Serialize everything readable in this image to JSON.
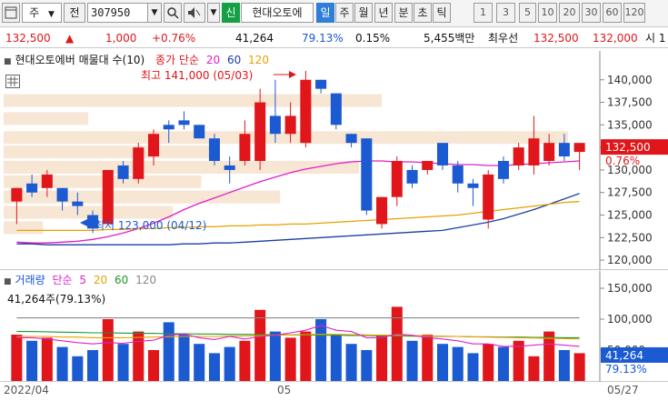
{
  "toolbar": {
    "chart_type_label": "주",
    "prev_label": "전",
    "code_value": "307950",
    "signal_label": "신",
    "stock_name": "현대오토에",
    "period_tabs": [
      "일",
      "주",
      "월",
      "년",
      "분",
      "초",
      "틱"
    ],
    "active_period": "일",
    "interval_buttons": [
      "1",
      "3",
      "5",
      "10",
      "20",
      "30",
      "60",
      "120"
    ]
  },
  "quote": {
    "price": "132,500",
    "direction": "▲",
    "change": "1,000",
    "change_pct": "+0.76%",
    "volume": "41,264",
    "volume_ratio": "79.13%",
    "turnover_ratio": "0.15%",
    "amount": "5,455백만",
    "best_ask_label": "최우선",
    "best_ask": "132,500",
    "best_bid": "132,000",
    "market_label": "시 1"
  },
  "price_panel": {
    "title": "현대오토에버 매물대 수(10)",
    "ma_label": "종가 단순",
    "ma_periods": [
      "20",
      "60",
      "120"
    ],
    "ma_colors": [
      "#e020c8",
      "#1d3fa0",
      "#e8a000"
    ],
    "high_annotation": "최고 141,000 (05/03)",
    "low_annotation": "최저 123,000 (04/12)",
    "current_price_tag": "132,500",
    "current_change_tag": "0.76%",
    "axis_labels": [
      "140,000",
      "137,500",
      "135,000",
      "132,500",
      "130,000",
      "127,500",
      "125,000",
      "122,500",
      "120,000"
    ]
  },
  "volume_panel": {
    "title": "거래량",
    "ma_label": "단순",
    "ma_periods": [
      "5",
      "20",
      "60",
      "120"
    ],
    "ma_colors": [
      "#e020c8",
      "#e8a000",
      "#1a9a2a",
      "#888888"
    ],
    "current_volume_text": "41,264주(79.13%)",
    "volume_tag": "41,264",
    "ratio_tag": "79.13%",
    "axis_labels": [
      "150,000",
      "100,000",
      "50,000"
    ]
  },
  "xaxis": {
    "labels": [
      "2022/04",
      "05",
      "05/27"
    ]
  },
  "colors": {
    "up": "#e0161b",
    "down": "#1c5ad2",
    "accent": "#2f7fd8",
    "volume_profile": "#f8e6d4"
  },
  "chart_data": [
    {
      "type": "candlestick",
      "ylim": [
        119000,
        143000
      ],
      "candles": [
        {
          "o": 126500,
          "h": 128000,
          "l": 124000,
          "c": 128000
        },
        {
          "o": 128500,
          "h": 129500,
          "l": 127000,
          "c": 127500
        },
        {
          "o": 128000,
          "h": 130000,
          "l": 127000,
          "c": 129500
        },
        {
          "o": 128000,
          "h": 128000,
          "l": 125500,
          "c": 126500
        },
        {
          "o": 126500,
          "h": 127500,
          "l": 125000,
          "c": 126000
        },
        {
          "o": 125000,
          "h": 125500,
          "l": 123000,
          "c": 123500
        },
        {
          "o": 124000,
          "h": 130000,
          "l": 124000,
          "c": 130000
        },
        {
          "o": 130500,
          "h": 131000,
          "l": 128500,
          "c": 129000
        },
        {
          "o": 129000,
          "h": 133000,
          "l": 128500,
          "c": 132500
        },
        {
          "o": 131500,
          "h": 134500,
          "l": 130500,
          "c": 134000
        },
        {
          "o": 135000,
          "h": 135500,
          "l": 133000,
          "c": 134500
        },
        {
          "o": 135500,
          "h": 136500,
          "l": 134500,
          "c": 135000
        },
        {
          "o": 135000,
          "h": 135000,
          "l": 133500,
          "c": 133500
        },
        {
          "o": 133500,
          "h": 134000,
          "l": 130500,
          "c": 131000
        },
        {
          "o": 130500,
          "h": 131500,
          "l": 128500,
          "c": 130000
        },
        {
          "o": 131000,
          "h": 135500,
          "l": 130500,
          "c": 134000
        },
        {
          "o": 131000,
          "h": 139000,
          "l": 130000,
          "c": 137500
        },
        {
          "o": 136000,
          "h": 140000,
          "l": 133000,
          "c": 134000
        },
        {
          "o": 134000,
          "h": 137500,
          "l": 133000,
          "c": 136000
        },
        {
          "o": 133000,
          "h": 141000,
          "l": 132500,
          "c": 140000
        },
        {
          "o": 140000,
          "h": 140000,
          "l": 138500,
          "c": 139000
        },
        {
          "o": 138500,
          "h": 138500,
          "l": 134500,
          "c": 135000
        },
        {
          "o": 134000,
          "h": 134000,
          "l": 132500,
          "c": 133000
        },
        {
          "o": 133500,
          "h": 133500,
          "l": 125000,
          "c": 125500
        },
        {
          "o": 124000,
          "h": 127000,
          "l": 123500,
          "c": 127000
        },
        {
          "o": 127000,
          "h": 131500,
          "l": 126000,
          "c": 131000
        },
        {
          "o": 130000,
          "h": 130500,
          "l": 128000,
          "c": 128500
        },
        {
          "o": 130000,
          "h": 130500,
          "l": 129500,
          "c": 131000
        },
        {
          "o": 133000,
          "h": 133000,
          "l": 130000,
          "c": 130500
        },
        {
          "o": 130500,
          "h": 131000,
          "l": 127500,
          "c": 128500
        },
        {
          "o": 128500,
          "h": 129000,
          "l": 126000,
          "c": 128000
        },
        {
          "o": 124500,
          "h": 130000,
          "l": 123500,
          "c": 129500
        },
        {
          "o": 131000,
          "h": 131500,
          "l": 128500,
          "c": 129000
        },
        {
          "o": 130500,
          "h": 133000,
          "l": 130000,
          "c": 132500
        },
        {
          "o": 130500,
          "h": 136000,
          "l": 129500,
          "c": 133500
        },
        {
          "o": 131000,
          "h": 134000,
          "l": 130500,
          "c": 133000
        },
        {
          "o": 133000,
          "h": 134000,
          "l": 131000,
          "c": 131500
        },
        {
          "o": 132000,
          "h": 132500,
          "l": 130000,
          "c": 133000
        }
      ],
      "ma20": [
        122000,
        121900,
        121900,
        122000,
        122100,
        122300,
        122600,
        123000,
        123500,
        124100,
        124800,
        125600,
        126300,
        126900,
        127500,
        128100,
        128700,
        129200,
        129700,
        130100,
        130400,
        130700,
        130900,
        131000,
        131000,
        130900,
        130900,
        130800,
        130700,
        130600,
        130600,
        130500,
        130500,
        130600,
        130700,
        130800,
        130900,
        131000
      ],
      "ma60": [
        121800,
        121800,
        121700,
        121700,
        121700,
        121700,
        121700,
        121700,
        121700,
        121700,
        121700,
        121800,
        121800,
        121900,
        121900,
        122000,
        122100,
        122200,
        122300,
        122400,
        122500,
        122600,
        122700,
        122800,
        122900,
        123000,
        123100,
        123200,
        123300,
        123600,
        123900,
        124200,
        124600,
        125100,
        125600,
        126200,
        126800,
        127400
      ],
      "ma120": [
        123300,
        123300,
        123300,
        123300,
        123300,
        123300,
        123400,
        123400,
        123500,
        123500,
        123600,
        123600,
        123700,
        123700,
        123800,
        123800,
        123900,
        123900,
        124000,
        124000,
        124100,
        124200,
        124300,
        124400,
        124500,
        124600,
        124700,
        124800,
        124900,
        125000,
        125200,
        125400,
        125600,
        125800,
        126000,
        126200,
        126400,
        126500
      ],
      "volume_profile": [
        {
          "price": 137700,
          "relative": 0.67
        },
        {
          "price": 135700,
          "relative": 0.15
        },
        {
          "price": 133600,
          "relative": 1.0
        },
        {
          "price": 132000,
          "relative": 0.38
        },
        {
          "price": 130300,
          "relative": 0.63
        },
        {
          "price": 128700,
          "relative": 0.35
        },
        {
          "price": 127000,
          "relative": 0.49
        },
        {
          "price": 125300,
          "relative": 0.3
        },
        {
          "price": 123600,
          "relative": 0.07
        }
      ]
    },
    {
      "type": "bar",
      "ylim": [
        0,
        175000
      ],
      "volume": [
        75000,
        65000,
        70000,
        55000,
        40000,
        50000,
        100000,
        60000,
        80000,
        50000,
        95000,
        75000,
        60000,
        45000,
        55000,
        65000,
        115000,
        80000,
        70000,
        80000,
        100000,
        75000,
        60000,
        50000,
        75000,
        120000,
        65000,
        75000,
        60000,
        55000,
        45000,
        60000,
        55000,
        65000,
        40000,
        80000,
        50000,
        45000
      ],
      "ma5": [
        70000,
        70000,
        68000,
        65000,
        62000,
        60000,
        62000,
        61000,
        64000,
        66000,
        74000,
        76000,
        70000,
        67000,
        72000,
        68000,
        72000,
        74000,
        78000,
        82000,
        90000,
        82000,
        80000,
        70000,
        70000,
        76000,
        74000,
        70000,
        68000,
        65000,
        60000,
        60000,
        56000,
        56000,
        58000,
        60000,
        58000,
        56000
      ],
      "ma20": [
        72000,
        72000,
        72000,
        71000,
        71000,
        70000,
        70000,
        70000,
        70500,
        71000,
        71500,
        72000,
        72000,
        72000,
        72500,
        73000,
        73500,
        74000,
        74500,
        75000,
        75500,
        75500,
        75000,
        74500,
        74000,
        74000,
        73500,
        73000,
        72500,
        72000,
        71500,
        71000,
        70500,
        70000,
        69500,
        69000,
        68500,
        68000
      ],
      "ma60": [
        80000,
        80000,
        79500,
        79000,
        78500,
        78000,
        78000,
        77500,
        77000,
        77000,
        76500,
        76500,
        76000,
        76000,
        75500,
        75500,
        75000,
        75000,
        74500,
        74500,
        74000,
        74000,
        73500,
        73500,
        73000,
        73000,
        72500,
        72500,
        72000,
        72000,
        71500,
        71500,
        71000,
        71000,
        70500,
        70500,
        70000,
        70000
      ],
      "ma120": [
        102000,
        102000,
        102000,
        102000,
        102000,
        102000,
        102000,
        102000,
        102000,
        102000,
        102000,
        102000,
        102000,
        102000,
        102000,
        102000,
        102000,
        102000,
        102000,
        102000,
        102000,
        102000,
        102000,
        102000,
        102000,
        102000,
        102000,
        102000,
        102000,
        102000,
        102000,
        102000,
        102000,
        102000,
        102000,
        102000,
        102000,
        102000
      ]
    }
  ]
}
